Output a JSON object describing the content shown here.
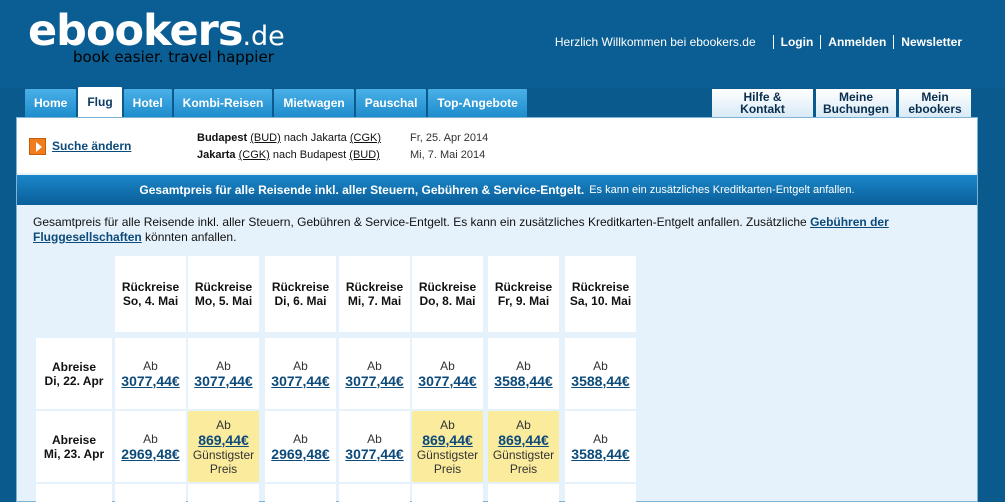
{
  "brand": {
    "name": "ebookers",
    "tld": ".de",
    "tagline": "book easier. travel happier"
  },
  "toplinks": {
    "welcome": "Herzlich Willkommen bei ebookers.de",
    "login": "Login",
    "register": "Anmelden",
    "newsletter": "Newsletter"
  },
  "nav": {
    "tabs": [
      "Home",
      "Flug",
      "Hotel",
      "Kombi-Reisen",
      "Mietwagen",
      "Pauschal",
      "Top-Angebote"
    ],
    "active": "Flug",
    "help": "Hilfe & Kontakt",
    "bookings": [
      "Meine",
      "Buchungen"
    ],
    "account": [
      "Mein",
      "ebookers"
    ]
  },
  "search": {
    "change_label": "Suche ändern",
    "outbound": {
      "from": "Budapest",
      "from_code": "(BUD)",
      "connector": "nach Jakarta",
      "to_code": "(CGK)",
      "date": "Fr, 25. Apr 2014"
    },
    "return": {
      "from": "Jakarta",
      "from_code": "(CGK)",
      "connector": "nach Budapest",
      "to_code": "(BUD)",
      "date": "Mi, 7. Mai 2014"
    }
  },
  "banner": {
    "bold": "Gesamtpreis für alle Reisende inkl. aller Steuern, Gebühren & Service-Entgelt.",
    "normal": "Es kann ein zusätzliches Kreditkarten-Entgelt anfallen."
  },
  "note": {
    "text": "Gesamtpreis für alle Reisende inkl. aller Steuern, Gebühren & Service-Entgelt. Es kann ein zusätzliches Kreditkarten-Entgelt anfallen. Zusätzliche ",
    "link": "Gebühren der Fluggesellschaften",
    "tail": " könnten anfallen."
  },
  "matrix": {
    "columns": [
      {
        "label": "Rückreise",
        "day": "So, 4. Mai"
      },
      {
        "label": "Rückreise",
        "day": "Mo, 5. Mai"
      },
      {
        "label": "Rückreise",
        "day": "Di, 6. Mai"
      },
      {
        "label": "Rückreise",
        "day": "Mi, 7. Mai"
      },
      {
        "label": "Rückreise",
        "day": "Do, 8. Mai"
      },
      {
        "label": "Rückreise",
        "day": "Fr, 9. Mai"
      },
      {
        "label": "Rückreise",
        "day": "Sa, 10. Mai"
      }
    ],
    "rows": [
      {
        "label": "Abreise",
        "day": "Di, 22. Apr",
        "cells": [
          {
            "prefix": "Ab",
            "price": "3077,44€"
          },
          {
            "prefix": "Ab",
            "price": "3077,44€"
          },
          {
            "prefix": "Ab",
            "price": "3077,44€"
          },
          {
            "prefix": "Ab",
            "price": "3077,44€"
          },
          {
            "prefix": "Ab",
            "price": "3077,44€"
          },
          {
            "prefix": "Ab",
            "price": "3588,44€"
          },
          {
            "prefix": "Ab",
            "price": "3588,44€"
          }
        ]
      },
      {
        "label": "Abreise",
        "day": "Mi, 23. Apr",
        "cells": [
          {
            "prefix": "Ab",
            "price": "2969,48€"
          },
          {
            "prefix": "Ab",
            "price": "869,44€",
            "best": true,
            "best_label": [
              "Günstigster",
              "Preis"
            ]
          },
          {
            "prefix": "Ab",
            "price": "2969,48€"
          },
          {
            "prefix": "Ab",
            "price": "3077,44€"
          },
          {
            "prefix": "Ab",
            "price": "869,44€",
            "best": true,
            "best_label": [
              "Günstigster",
              "Preis"
            ]
          },
          {
            "prefix": "Ab",
            "price": "869,44€",
            "best": true,
            "best_label": [
              "Günstigster",
              "Preis"
            ]
          },
          {
            "prefix": "Ab",
            "price": "3588,44€"
          }
        ]
      }
    ]
  }
}
